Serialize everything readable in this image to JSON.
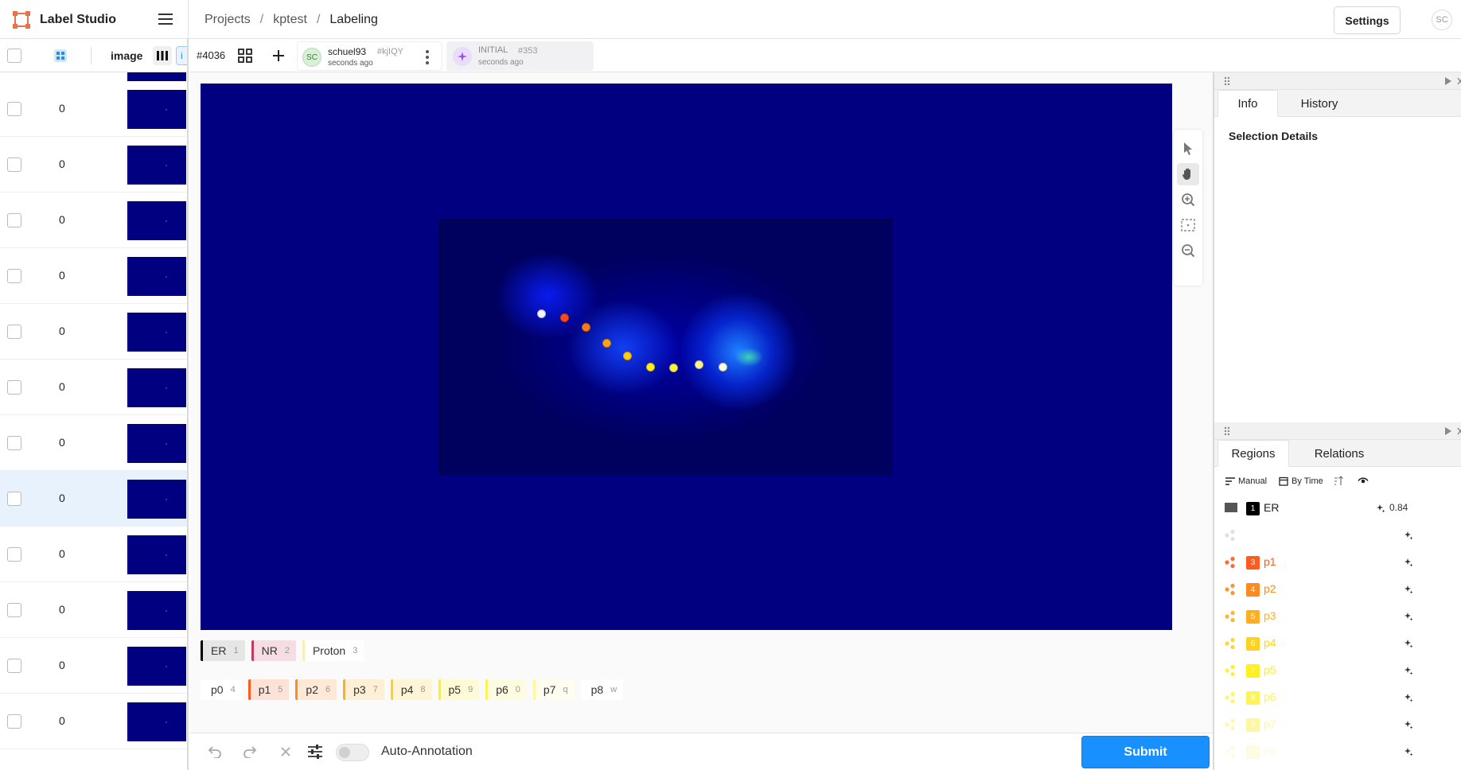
{
  "app": {
    "name": "Label Studio"
  },
  "breadcrumb": {
    "projects": "Projects",
    "sep1": "/",
    "project": "kptest",
    "sep2": "/",
    "page": "Labeling"
  },
  "header": {
    "settings_label": "Settings",
    "avatar": "SC"
  },
  "list": {
    "column_label": "image",
    "rows": [
      {
        "value": "0"
      },
      {
        "value": "0"
      },
      {
        "value": "0"
      },
      {
        "value": "0"
      },
      {
        "value": "0"
      },
      {
        "value": "0"
      },
      {
        "value": "0"
      },
      {
        "value": "0"
      },
      {
        "value": "0"
      },
      {
        "value": "0"
      },
      {
        "value": "0"
      },
      {
        "value": "0"
      }
    ],
    "selected_row": 7
  },
  "task": {
    "id": "#4036",
    "annotation": {
      "avatar": "SC",
      "user": "schuel93",
      "id": "#kjIQY",
      "time": "seconds ago"
    },
    "prediction": {
      "label": "INITIAL",
      "id": "#353",
      "time": "seconds ago"
    }
  },
  "labels_row1": [
    {
      "name": "ER",
      "key": "1",
      "color": "#000000",
      "bg": "#e6e6e6"
    },
    {
      "name": "NR",
      "key": "2",
      "color": "#c33a5a",
      "bg": "#f6dde3"
    },
    {
      "name": "Proton",
      "key": "3",
      "color": "#f5f0b0",
      "bg": "#ffffff"
    }
  ],
  "labels_row2": [
    {
      "name": "p0",
      "key": "4",
      "color": "#ffffff",
      "bg": "#ffffff"
    },
    {
      "name": "p1",
      "key": "5",
      "color": "#ff5a1f",
      "bg": "#fde3d7"
    },
    {
      "name": "p2",
      "key": "6",
      "color": "#ff8a1f",
      "bg": "#fde9d6"
    },
    {
      "name": "p3",
      "key": "7",
      "color": "#ffae1f",
      "bg": "#fdf0d6"
    },
    {
      "name": "p4",
      "key": "8",
      "color": "#ffd21f",
      "bg": "#fdf5d6"
    },
    {
      "name": "p5",
      "key": "9",
      "color": "#fff01f",
      "bg": "#fdfbd6"
    },
    {
      "name": "p6",
      "key": "0",
      "color": "#fff35a",
      "bg": "#fdfce0"
    },
    {
      "name": "p7",
      "key": "q",
      "color": "#fff6a0",
      "bg": "#fffdf0"
    },
    {
      "name": "p8",
      "key": "w",
      "color": "#ffffff",
      "bg": "#ffffff"
    }
  ],
  "keypoints": [
    {
      "label": "p0",
      "color": "#f4f4ff"
    },
    {
      "label": "p1",
      "color": "#ff4a16"
    },
    {
      "label": "p2",
      "color": "#ff7a16"
    },
    {
      "label": "p3",
      "color": "#ffa316"
    },
    {
      "label": "p4",
      "color": "#ffcc16"
    },
    {
      "label": "p5",
      "color": "#ffee16"
    },
    {
      "label": "p6",
      "color": "#fff23a"
    },
    {
      "label": "p7",
      "color": "#fff58a"
    },
    {
      "label": "p8",
      "color": "#fdfde0"
    }
  ],
  "bottom": {
    "auto_annotation": "Auto-Annotation",
    "submit_label": "Submit"
  },
  "right": {
    "tabs1": {
      "info": "Info",
      "history": "History"
    },
    "selection_details": "Selection Details",
    "tabs2": {
      "regions": "Regions",
      "relations": "Relations"
    },
    "controls": {
      "manual": "Manual",
      "by_time": "By Time"
    },
    "regions": [
      {
        "num": "1",
        "name": "ER",
        "color": "#000000",
        "score": "0.84"
      },
      {
        "num": "",
        "name": "",
        "color": "#dddddd",
        "score": ""
      },
      {
        "num": "3",
        "name": "p1",
        "color": "#ff5a1f",
        "score": ""
      },
      {
        "num": "4",
        "name": "p2",
        "color": "#ff8a1f",
        "score": ""
      },
      {
        "num": "5",
        "name": "p3",
        "color": "#ffae1f",
        "score": ""
      },
      {
        "num": "6",
        "name": "p4",
        "color": "#ffd21f",
        "score": ""
      },
      {
        "num": "7",
        "name": "p5",
        "color": "#fff01f",
        "score": ""
      },
      {
        "num": "8",
        "name": "p6",
        "color": "#fff35a",
        "score": ""
      },
      {
        "num": "9",
        "name": "p7",
        "color": "#fff6a0",
        "score": ""
      },
      {
        "num": "10",
        "name": "p8",
        "color": "#fffbe0",
        "score": ""
      }
    ]
  }
}
